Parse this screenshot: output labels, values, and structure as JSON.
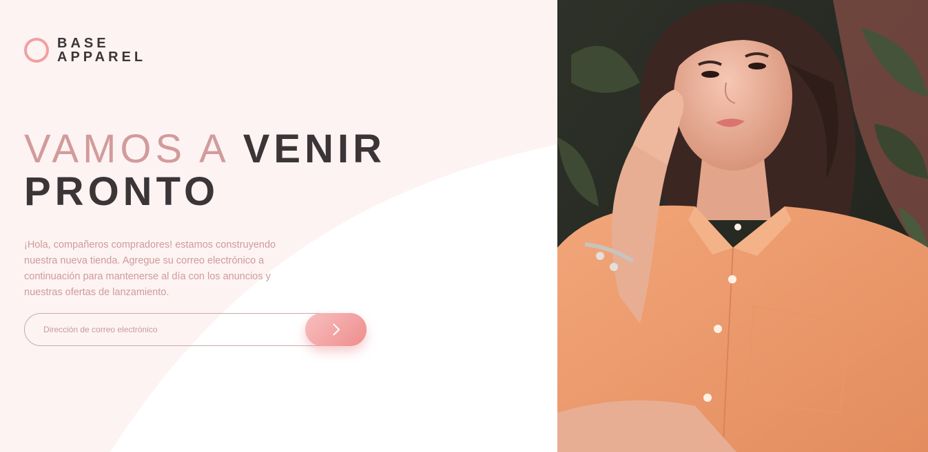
{
  "brand": {
    "line1": "BASE",
    "line2": "APPAREL",
    "accent_color": "#f29f9f",
    "dark_color": "#3b3537"
  },
  "hero": {
    "headline_light": "VAMOS A",
    "headline_dark_1": "VENIR",
    "headline_dark_2": "PRONTO",
    "intro": "¡Hola, compañeros compradores! estamos construyendo nuestra nueva tienda. Agregue su correo electrónico a continuación para mantenerse al día con los anuncios y nuestras ofertas de lanzamiento."
  },
  "form": {
    "email_placeholder": "Dirección de correo electrónico",
    "email_value": "",
    "submit_icon": "chevron-right-icon"
  },
  "image": {
    "subject": "portrait-photo-woman-orange-shirt"
  }
}
